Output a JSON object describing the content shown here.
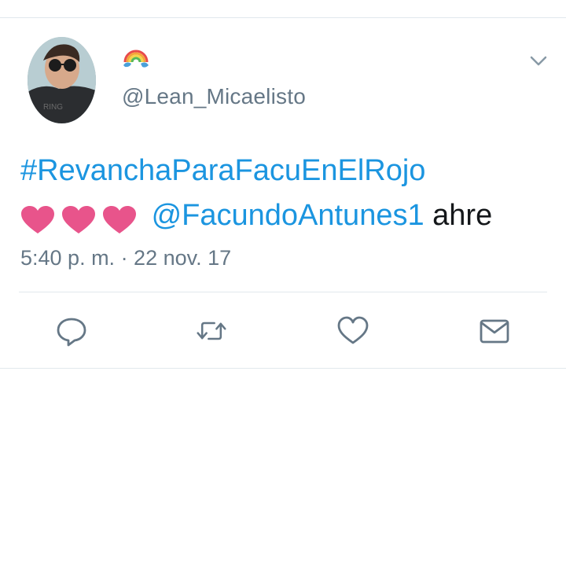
{
  "tweet": {
    "display_name_icon": "rainbow-emoji-icon",
    "handle": "@Lean_Micaelisto",
    "text": {
      "hashtag": "#RevanchaParaFacuEnElRojo",
      "hearts": [
        "heart-emoji-icon",
        "heart-emoji-icon",
        "heart-emoji-icon"
      ],
      "mention": "@FacundoAntunes1",
      "suffix": " ahre"
    },
    "timestamp": "5:40 p. m. · 22 nov. 17"
  },
  "actions": [
    "reply-icon",
    "retweet-icon",
    "like-icon",
    "direct-message-icon"
  ],
  "colors": {
    "link": "#1b95e0",
    "text": "#14171a",
    "secondary": "#657786",
    "icon": "#657786",
    "divider": "#e1e8ed",
    "heart": "#e8548b"
  }
}
